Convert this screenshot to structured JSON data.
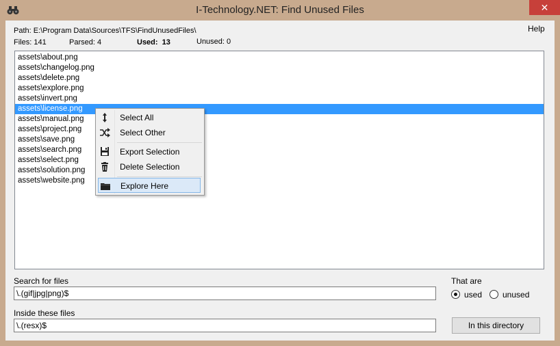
{
  "window": {
    "title": "I-Technology.NET: Find Unused Files",
    "close_glyph": "✕"
  },
  "header": {
    "path": "Path: E:\\Program Data\\Sources\\TFS\\FindUnusedFiles\\",
    "help": "Help",
    "files": "Files: 141",
    "parsed": "Parsed: 4",
    "used": "Used:  13",
    "unused": "Unused: 0"
  },
  "file_list": {
    "selected_index": 5,
    "items": [
      "assets\\about.png",
      "assets\\changelog.png",
      "assets\\delete.png",
      "assets\\explore.png",
      "assets\\invert.png",
      "assets\\license.png",
      "assets\\manual.png",
      "assets\\project.png",
      "assets\\save.png",
      "assets\\search.png",
      "assets\\select.png",
      "assets\\solution.png",
      "assets\\website.png"
    ]
  },
  "context_menu": {
    "items": [
      {
        "label": "Select All",
        "icon": "sort-arrows-icon"
      },
      {
        "label": "Select Other",
        "icon": "shuffle-icon"
      },
      {
        "label": "Export Selection",
        "icon": "floppy-disk-icon"
      },
      {
        "label": "Delete Selection",
        "icon": "trash-icon"
      },
      {
        "label": "Explore Here",
        "icon": "folder-icon",
        "highlighted": true
      }
    ]
  },
  "search": {
    "files_label": "Search for files",
    "files_value": "\\.(gif|jpg|png)$",
    "inside_label": "Inside these files",
    "inside_value": "\\.(resx)$"
  },
  "that_are": {
    "label": "That are",
    "options": [
      "used",
      "unused"
    ],
    "selected": "used"
  },
  "directory_button": "In this directory",
  "colors": {
    "selection": "#3399ff",
    "menu_highlight": "#dbe9f8",
    "close_button": "#c7403a",
    "frame": "#c8aa8e"
  }
}
